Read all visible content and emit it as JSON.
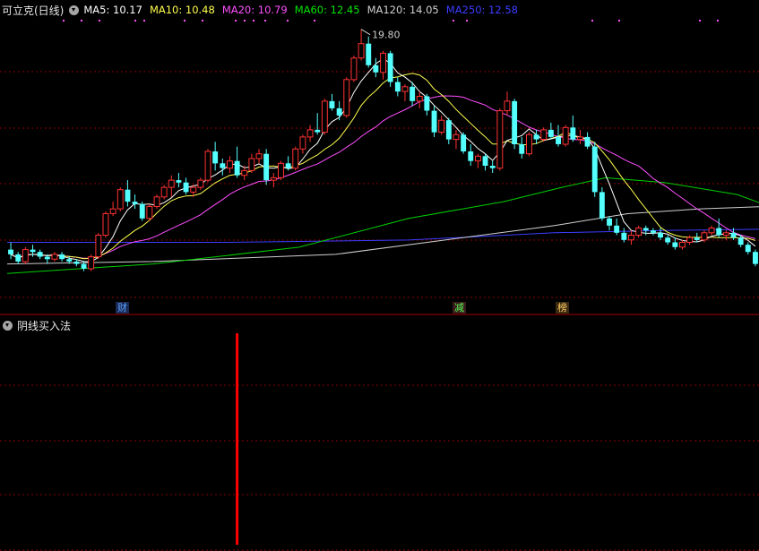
{
  "header": {
    "stock_title": "可立克(日线)",
    "ma_labels": [
      {
        "name": "MA5",
        "text": "MA5: 10.17",
        "color": "#ffffff"
      },
      {
        "name": "MA10",
        "text": "MA10: 10.48",
        "color": "#ffff4f"
      },
      {
        "name": "MA20",
        "text": "MA20: 10.79",
        "color": "#ff4fff"
      },
      {
        "name": "MA60",
        "text": "MA60: 12.45",
        "color": "#00e600"
      },
      {
        "name": "MA120",
        "text": "MA120: 14.05",
        "color": "#d0d0d0"
      },
      {
        "name": "MA250",
        "text": "MA250: 12.58",
        "color": "#3c3cff"
      }
    ]
  },
  "annotations": {
    "high_price": "19.80"
  },
  "badges": [
    {
      "name": "badge-cai",
      "text": "财",
      "color": "#5aa0ff"
    },
    {
      "name": "badge-jiancheng",
      "text": "减",
      "color": "#55ff55"
    },
    {
      "name": "badge-bang",
      "text": "榜",
      "color": "#ffcc66"
    }
  ],
  "indicator": {
    "title": "阴线买入法"
  },
  "colors": {
    "up": "#ff3232",
    "down": "#54ffff",
    "grid": "#8b0000",
    "signal": "#ff0000"
  },
  "chart_data": {
    "type": "candlestick",
    "y_axis": {
      "min": 8.6,
      "max": 20.2
    },
    "candles": [
      [
        10.6,
        10.9,
        10.2,
        10.4
      ],
      [
        10.4,
        10.5,
        10.0,
        10.1
      ],
      [
        10.1,
        10.7,
        10.0,
        10.6
      ],
      [
        10.6,
        10.8,
        10.3,
        10.5
      ],
      [
        10.5,
        10.6,
        10.2,
        10.3
      ],
      [
        10.3,
        10.4,
        10.0,
        10.2
      ],
      [
        10.2,
        10.5,
        10.1,
        10.4
      ],
      [
        10.4,
        10.5,
        10.1,
        10.2
      ],
      [
        10.2,
        10.3,
        10.0,
        10.1
      ],
      [
        10.1,
        10.2,
        9.9,
        10.0
      ],
      [
        10.0,
        10.1,
        9.7,
        9.8
      ],
      [
        9.8,
        10.4,
        9.7,
        10.3
      ],
      [
        10.3,
        11.3,
        10.2,
        11.2
      ],
      [
        11.2,
        12.2,
        11.1,
        12.1
      ],
      [
        12.1,
        12.6,
        12.0,
        12.3
      ],
      [
        12.3,
        13.2,
        12.2,
        13.1
      ],
      [
        13.1,
        13.5,
        12.4,
        12.6
      ],
      [
        12.6,
        12.9,
        12.3,
        12.5
      ],
      [
        12.5,
        12.6,
        11.8,
        11.9
      ],
      [
        11.9,
        12.5,
        11.8,
        12.4
      ],
      [
        12.4,
        12.9,
        12.3,
        12.8
      ],
      [
        12.8,
        13.3,
        12.7,
        13.2
      ],
      [
        13.2,
        13.7,
        12.8,
        13.5
      ],
      [
        13.5,
        13.8,
        13.2,
        13.4
      ],
      [
        13.4,
        13.6,
        12.9,
        13.0
      ],
      [
        13.0,
        13.3,
        12.8,
        13.2
      ],
      [
        13.2,
        13.6,
        13.1,
        13.5
      ],
      [
        13.5,
        14.8,
        13.4,
        14.7
      ],
      [
        14.7,
        15.1,
        13.9,
        14.2
      ],
      [
        14.2,
        14.4,
        13.7,
        14.0
      ],
      [
        14.0,
        14.5,
        13.8,
        14.3
      ],
      [
        14.3,
        14.9,
        13.6,
        13.7
      ],
      [
        13.7,
        14.1,
        13.5,
        13.9
      ],
      [
        13.9,
        14.6,
        13.8,
        14.4
      ],
      [
        14.4,
        14.8,
        14.2,
        14.6
      ],
      [
        14.6,
        14.8,
        13.3,
        13.5
      ],
      [
        13.5,
        13.8,
        13.2,
        13.6
      ],
      [
        13.6,
        14.3,
        13.5,
        14.2
      ],
      [
        14.2,
        14.5,
        13.9,
        14.0
      ],
      [
        14.0,
        14.9,
        13.9,
        14.8
      ],
      [
        14.8,
        15.4,
        14.6,
        15.3
      ],
      [
        15.3,
        15.8,
        15.1,
        15.6
      ],
      [
        15.6,
        16.3,
        15.4,
        15.5
      ],
      [
        15.5,
        16.9,
        15.4,
        16.8
      ],
      [
        16.8,
        17.1,
        16.4,
        16.5
      ],
      [
        16.5,
        16.8,
        16.0,
        16.2
      ],
      [
        16.2,
        17.8,
        16.1,
        17.7
      ],
      [
        17.7,
        18.7,
        17.6,
        18.6
      ],
      [
        18.6,
        19.8,
        18.5,
        19.2
      ],
      [
        19.2,
        19.5,
        18.2,
        18.3
      ],
      [
        18.3,
        18.6,
        17.8,
        18.0
      ],
      [
        18.0,
        18.9,
        17.7,
        18.8
      ],
      [
        18.8,
        18.9,
        17.4,
        17.6
      ],
      [
        17.6,
        17.8,
        17.0,
        17.2
      ],
      [
        17.2,
        17.5,
        16.8,
        17.4
      ],
      [
        17.4,
        17.6,
        16.6,
        16.8
      ],
      [
        16.8,
        17.2,
        16.5,
        17.0
      ],
      [
        17.0,
        17.1,
        16.2,
        16.4
      ],
      [
        16.4,
        16.6,
        15.3,
        15.5
      ],
      [
        15.5,
        16.2,
        15.4,
        16.0
      ],
      [
        16.0,
        16.1,
        15.0,
        15.2
      ],
      [
        15.2,
        15.6,
        14.8,
        15.4
      ],
      [
        15.4,
        15.5,
        14.6,
        14.7
      ],
      [
        14.7,
        15.0,
        14.1,
        14.3
      ],
      [
        14.3,
        14.6,
        14.0,
        14.5
      ],
      [
        14.5,
        14.6,
        13.9,
        14.1
      ],
      [
        14.1,
        14.3,
        13.8,
        14.0
      ],
      [
        14.0,
        16.5,
        13.9,
        16.4
      ],
      [
        16.4,
        17.2,
        16.2,
        16.8
      ],
      [
        16.8,
        16.9,
        14.8,
        15.0
      ],
      [
        15.0,
        15.3,
        14.4,
        14.6
      ],
      [
        14.6,
        15.5,
        14.5,
        15.4
      ],
      [
        15.4,
        15.6,
        15.0,
        15.2
      ],
      [
        15.2,
        15.7,
        15.1,
        15.6
      ],
      [
        15.6,
        15.9,
        15.2,
        15.3
      ],
      [
        15.3,
        15.8,
        14.9,
        15.0
      ],
      [
        15.0,
        15.8,
        14.9,
        15.7
      ],
      [
        15.7,
        16.2,
        15.1,
        15.2
      ],
      [
        15.2,
        15.6,
        15.0,
        15.3
      ],
      [
        15.3,
        15.5,
        14.8,
        14.9
      ],
      [
        14.9,
        15.1,
        12.8,
        13.0
      ],
      [
        13.0,
        13.2,
        11.8,
        11.9
      ],
      [
        11.9,
        12.0,
        11.4,
        11.6
      ],
      [
        11.6,
        11.9,
        11.2,
        11.3
      ],
      [
        11.3,
        11.5,
        10.9,
        11.0
      ],
      [
        11.0,
        11.4,
        10.8,
        11.2
      ],
      [
        11.2,
        11.6,
        11.1,
        11.5
      ],
      [
        11.5,
        11.6,
        11.2,
        11.4
      ],
      [
        11.4,
        11.5,
        11.2,
        11.3
      ],
      [
        11.3,
        11.5,
        11.0,
        11.1
      ],
      [
        11.1,
        11.2,
        10.8,
        10.9
      ],
      [
        10.9,
        11.1,
        10.6,
        10.7
      ],
      [
        10.7,
        11.0,
        10.6,
        10.9
      ],
      [
        10.9,
        11.2,
        10.8,
        11.1
      ],
      [
        11.1,
        11.3,
        10.9,
        11.0
      ],
      [
        11.0,
        11.4,
        10.9,
        11.3
      ],
      [
        11.3,
        11.6,
        11.2,
        11.5
      ],
      [
        11.5,
        11.9,
        11.1,
        11.2
      ],
      [
        11.2,
        11.4,
        11.0,
        11.3
      ],
      [
        11.3,
        11.5,
        11.0,
        11.1
      ],
      [
        11.1,
        11.2,
        10.7,
        10.8
      ],
      [
        10.8,
        10.9,
        10.4,
        10.5
      ],
      [
        10.5,
        10.6,
        9.9,
        10.0
      ]
    ],
    "ma_long": {
      "MA60_points": [
        [
          0,
          9.6
        ],
        [
          20,
          10.0
        ],
        [
          40,
          10.7
        ],
        [
          55,
          11.9
        ],
        [
          68,
          12.6
        ],
        [
          76,
          13.2
        ],
        [
          82,
          13.6
        ],
        [
          90,
          13.4
        ],
        [
          100,
          12.9
        ],
        [
          104,
          12.45
        ]
      ],
      "MA120_points": [
        [
          0,
          10.0
        ],
        [
          20,
          10.1
        ],
        [
          45,
          10.4
        ],
        [
          60,
          11.0
        ],
        [
          75,
          11.6
        ],
        [
          85,
          12.1
        ],
        [
          95,
          12.3
        ],
        [
          104,
          12.4
        ]
      ],
      "MA250_points": [
        [
          0,
          10.9
        ],
        [
          30,
          10.9
        ],
        [
          55,
          11.0
        ],
        [
          75,
          11.3
        ],
        [
          90,
          11.4
        ],
        [
          104,
          11.45
        ]
      ]
    },
    "signal_index": 31
  }
}
